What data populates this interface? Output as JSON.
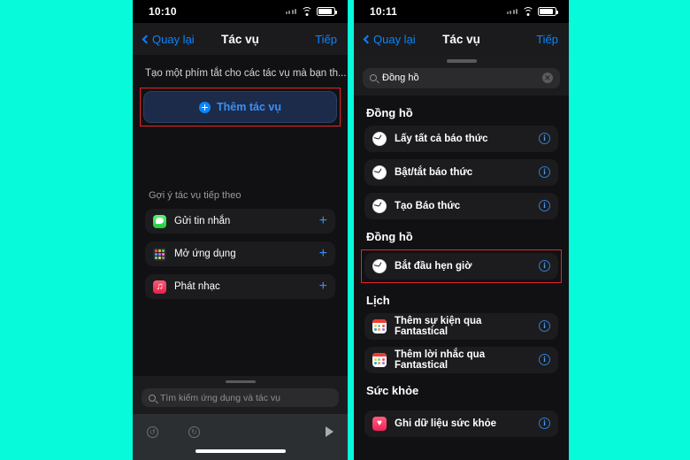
{
  "theme": {
    "background": "#07fada",
    "accent_blue": "#0a84ff",
    "highlight_red": "#e8232a",
    "row_bg": "#1c1c1e",
    "screen_bg": "#111113"
  },
  "left_phone": {
    "status_bar": {
      "time": "10:10",
      "wifi_icon": "wifi-icon",
      "battery_icon": "battery-icon",
      "signal_icon": "signal-dots-icon"
    },
    "nav": {
      "back_label": "Quay lại",
      "title": "Tác vụ",
      "next_label": "Tiếp"
    },
    "description": "Tạo một phím tắt cho các tác vụ mà bạn th...",
    "add_action_button": {
      "label": "Thêm tác vụ",
      "icon": "plus-circle-icon"
    },
    "suggestions_header": "Gợi ý tác vụ tiếp theo",
    "suggestions": [
      {
        "label": "Gửi tin nhắn",
        "icon": "messages-app-icon",
        "action": "+"
      },
      {
        "label": "Mở ứng dụng",
        "icon": "app-library-icon",
        "action": "+"
      },
      {
        "label": "Phát nhạc",
        "icon": "music-app-icon",
        "action": "+"
      }
    ],
    "bottom": {
      "search_placeholder": "Tìm kiếm ứng dụng và tác vụ",
      "search_icon": "search-icon",
      "undo_icon": "undo-icon",
      "redo_icon": "redo-icon",
      "run_icon": "play-icon"
    }
  },
  "right_phone": {
    "status_bar": {
      "time": "10:11",
      "wifi_icon": "wifi-icon",
      "battery_icon": "battery-icon",
      "signal_icon": "signal-dots-icon"
    },
    "nav": {
      "back_label": "Quay lại",
      "title": "Tác vụ",
      "next_label": "Tiếp"
    },
    "search": {
      "value": "Đồng hồ",
      "search_icon": "search-icon",
      "clear_icon": "clear-icon"
    },
    "sections": [
      {
        "header": "Đồng hồ",
        "rows": [
          {
            "label": "Lấy tất cả báo thức",
            "icon": "clock-app-icon",
            "info": "i"
          },
          {
            "label": "Bật/tắt báo thức",
            "icon": "clock-app-icon",
            "info": "i"
          },
          {
            "label": "Tạo Báo thức",
            "icon": "clock-app-icon",
            "info": "i"
          }
        ]
      },
      {
        "header": "Đồng hồ",
        "rows": [
          {
            "label": "Bắt đầu hẹn giờ",
            "icon": "clock-app-icon",
            "info": "i",
            "highlighted": true
          }
        ]
      },
      {
        "header": "Lịch",
        "rows": [
          {
            "label": "Thêm sự kiện qua Fantastical",
            "icon": "fantastical-app-icon",
            "info": "i"
          },
          {
            "label": "Thêm lời nhắc qua Fantastical",
            "icon": "fantastical-app-icon",
            "info": "i"
          }
        ]
      },
      {
        "header": "Sức khỏe",
        "rows": [
          {
            "label": "Ghi dữ liệu sức khỏe",
            "icon": "health-app-icon",
            "info": "i"
          }
        ]
      }
    ]
  }
}
